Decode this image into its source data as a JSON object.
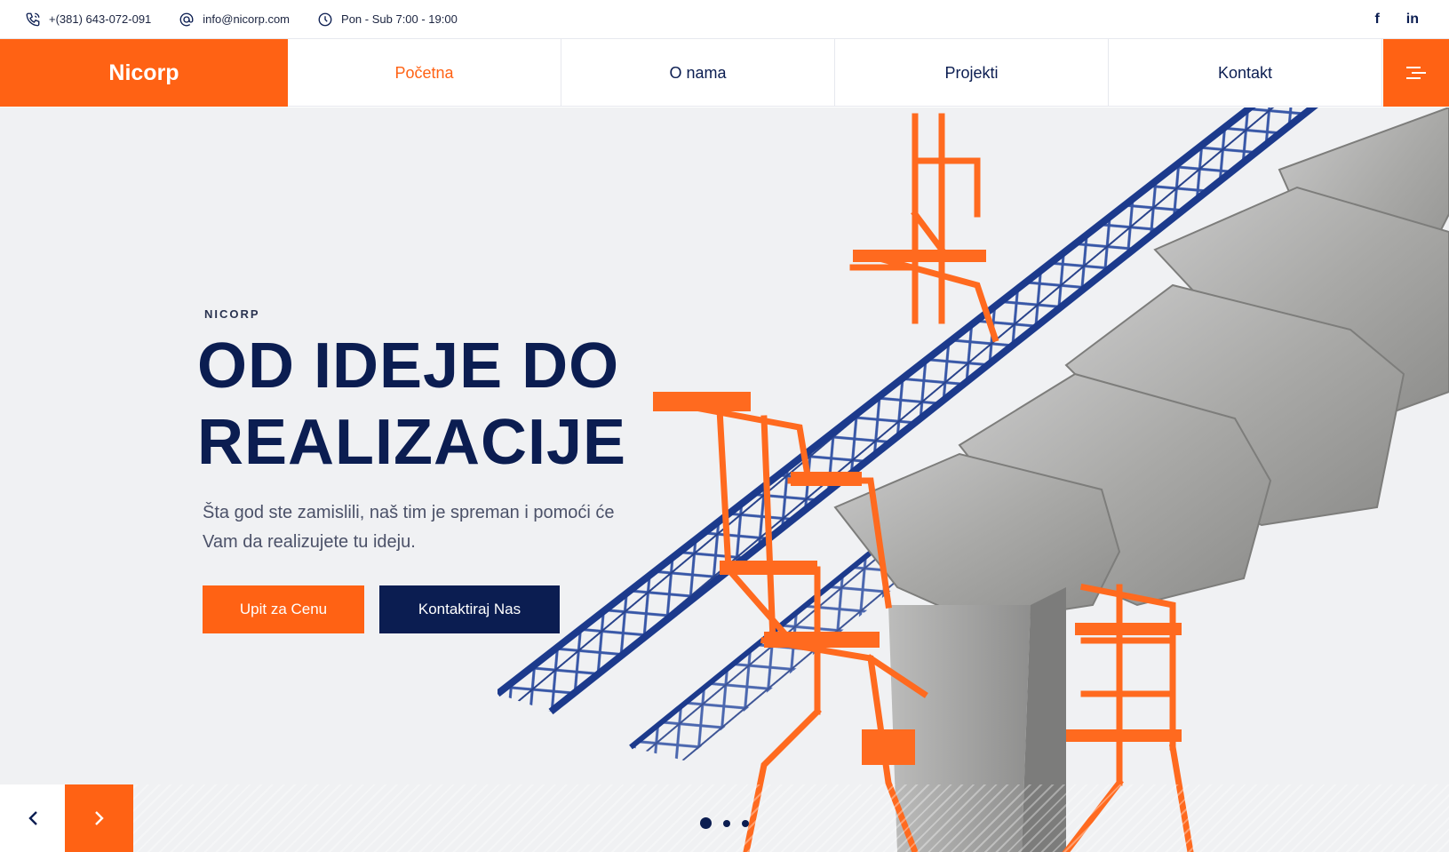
{
  "topbar": {
    "phone": "+(381) 643-072-091",
    "email": "info@nicorp.com",
    "hours": "Pon - Sub 7:00 - 19:00",
    "social": {
      "facebook": "f",
      "linkedin": "in"
    }
  },
  "nav": {
    "brand": "Nicorp",
    "items": [
      {
        "label": "Početna",
        "active": true
      },
      {
        "label": "O nama"
      },
      {
        "label": "Projekti"
      },
      {
        "label": "Kontakt"
      }
    ]
  },
  "hero": {
    "eyebrow": "NICORP",
    "headline_line1": "OD IDEJE DO",
    "headline_line2": "REALIZACIJE",
    "subtext": "Šta god ste zamislili, naš tim je spreman i pomoći će Vam da realizujete tu ideju.",
    "primary_button": "Upit za Cenu",
    "secondary_button": "Kontaktiraj Nas",
    "slides_total": 3,
    "active_slide": 1
  },
  "colors": {
    "accent": "#ff6214",
    "navy": "#0b1d51",
    "hero_bg": "#f0f1f3"
  }
}
